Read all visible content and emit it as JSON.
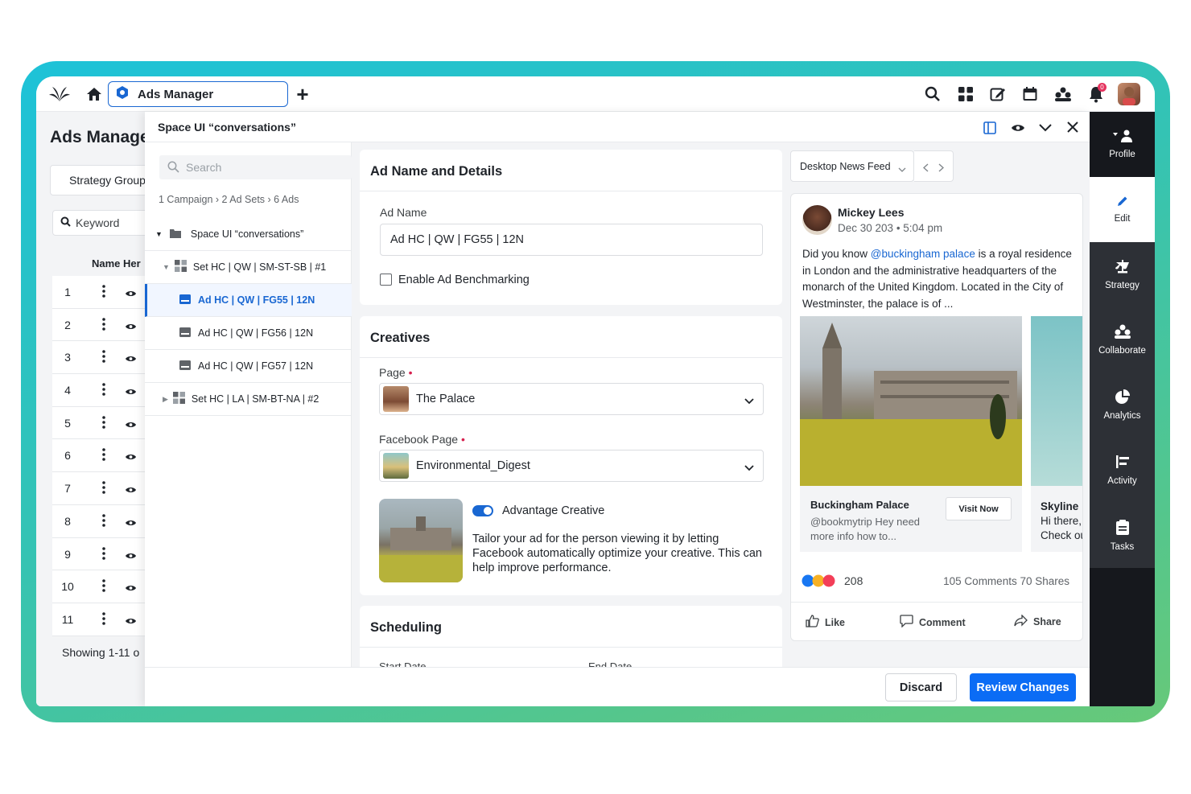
{
  "topbar": {
    "tab_label": "Ads Manager",
    "notification_count": "0"
  },
  "background_page": {
    "title": "Ads Manage",
    "strategy_button": "Strategy Group",
    "keyword_placeholder": "Keyword",
    "name_header": "Name Her",
    "rows": [
      "1",
      "2",
      "3",
      "4",
      "5",
      "6",
      "7",
      "8",
      "9",
      "10",
      "11"
    ],
    "footer": "Showing 1-11 o"
  },
  "modal": {
    "title": "Space UI “conversations”",
    "tree": {
      "search_placeholder": "Search",
      "crumb": {
        "campaign": "1 Campaign",
        "adsets": "2 Ad Sets",
        "ads": "6 Ads"
      },
      "campaign": "Space UI “conversations”",
      "adset1": "Set HC | QW | SM-ST-SB | #1",
      "ads": [
        "Ad HC | QW | FG55 | 12N",
        "Ad HC | QW | FG56 | 12N",
        "Ad HC | QW | FG57 | 12N"
      ],
      "adset2": "Set HC | LA | SM-BT-NA | #2"
    },
    "details": {
      "heading": "Ad Name and Details",
      "ad_name_label": "Ad Name",
      "ad_name_value": "Ad HC | QW | FG55 | 12N",
      "benchmark_label": "Enable Ad Benchmarking"
    },
    "creatives": {
      "heading": "Creatives",
      "page_label": "Page",
      "page_value": "The Palace",
      "fb_page_label": "Facebook Page",
      "fb_page_value": "Environmental_Digest",
      "advantage_title": "Advantage Creative",
      "advantage_desc": "Tailor your ad for the person viewing it by letting Facebook automatically optimize your creative. This can help improve performance."
    },
    "scheduling": {
      "heading": "Scheduling",
      "start_label": "Start Date",
      "end_label": "End Date"
    },
    "preview": {
      "placement": "Desktop News Feed",
      "author": "Mickey Lees",
      "date": "Dec 30 203",
      "time": "5:04 pm",
      "text_before": "Did you know ",
      "mention": "@buckingham palace",
      "text_after": " is a royal residence in London and the administrative headquarters of the monarch of the United Kingdom. Located in the City of Westminster, the palace is of ...",
      "card1_title": "Buckingham Palace",
      "card1_desc": "@bookmytrip Hey need more info how to...",
      "card1_cta": "Visit Now",
      "card2_title": "Skyline",
      "card2_desc1": "Hi there,",
      "card2_desc2": "Check ou",
      "reactions_count": "208",
      "comments_shares": "105 Comments 70 Shares",
      "like": "Like",
      "comment": "Comment",
      "share": "Share"
    },
    "footer": {
      "discard": "Discard",
      "review": "Review Changes"
    }
  },
  "rail": {
    "items": [
      "Profile",
      "Edit",
      "Strategy",
      "Collaborate",
      "Analytics",
      "Activity",
      "Tasks"
    ]
  },
  "colors": {
    "accent": "#1967d2",
    "primary_button": "#0b6cf5",
    "rail_dark": "#16181d",
    "rail_mid": "#2d3036",
    "frame_gradient_start": "#1dc2d8",
    "frame_gradient_end": "#67c979"
  }
}
